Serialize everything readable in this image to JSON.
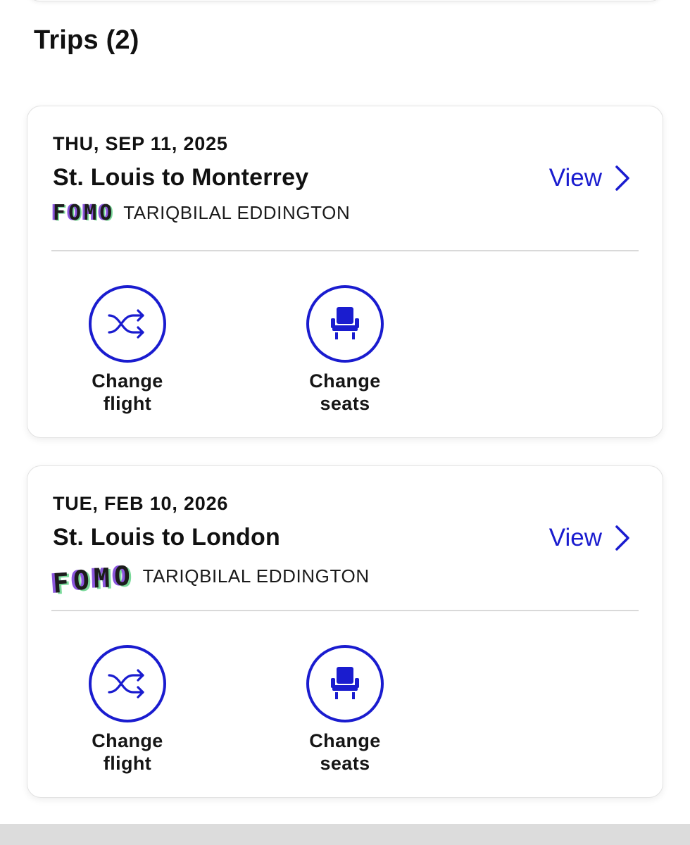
{
  "section": {
    "title": "Trips (2)"
  },
  "trips": [
    {
      "date": "THU, SEP 11, 2025",
      "route": "St. Louis to Monterrey",
      "view_label": "View",
      "sticker": [
        "F",
        "O",
        "M",
        "O"
      ],
      "passenger": "TARIQBILAL EDDINGTON",
      "actions": [
        {
          "line1": "Change",
          "line2": "flight",
          "icon": "shuffle-icon"
        },
        {
          "line1": "Change",
          "line2": "seats",
          "icon": "seat-icon"
        }
      ]
    },
    {
      "date": "TUE, FEB 10, 2026",
      "route": "St. Louis to London",
      "view_label": "View",
      "sticker": [
        "F",
        "O",
        "M",
        "O"
      ],
      "passenger": "TARIQBILAL EDDINGTON",
      "actions": [
        {
          "line1": "Change",
          "line2": "flight",
          "icon": "shuffle-icon"
        },
        {
          "line1": "Change",
          "line2": "seats",
          "icon": "seat-icon"
        }
      ]
    }
  ],
  "colors": {
    "accent": "#1a1ccf",
    "divider": "#d9d9d9",
    "card_border": "#e2e2e2"
  }
}
